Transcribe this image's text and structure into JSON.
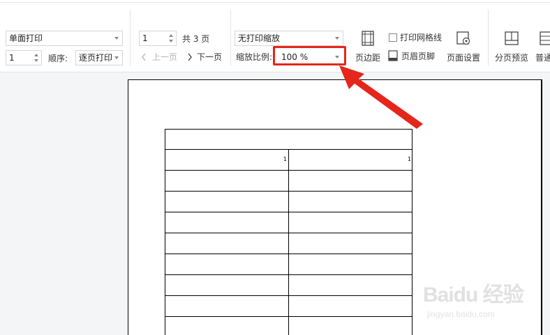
{
  "toolbar": {
    "print_mode": "单面打印",
    "copies": "1",
    "order_label": "顺序:",
    "order_value": "逐页打印",
    "page_number": "1",
    "total_pages": "共 3 页",
    "prev_page": "上一页",
    "next_page": "下一页",
    "scale_mode": "无打印缩放",
    "scale_label": "缩放比例:",
    "scale_value": "100 %",
    "print_gridlines": "打印网格线",
    "margins": "页边距",
    "header_footer": "页眉页脚",
    "page_setup": "页面设置",
    "page_break_preview": "分页预览",
    "normal_view": "普通"
  },
  "sheet": {
    "rows": [
      [
        "",
        ""
      ],
      [
        "1",
        "1"
      ],
      [
        "",
        ""
      ],
      [
        "",
        ""
      ],
      [
        "",
        ""
      ],
      [
        "",
        ""
      ],
      [
        "",
        ""
      ],
      [
        "",
        ""
      ],
      [
        "",
        ""
      ],
      [
        "",
        ""
      ]
    ]
  },
  "watermark": {
    "text": "Baidu 经验",
    "url": "jingyan.baidu.com"
  },
  "colors": {
    "highlight": "#e5261b",
    "arrow": "#e5261b"
  }
}
